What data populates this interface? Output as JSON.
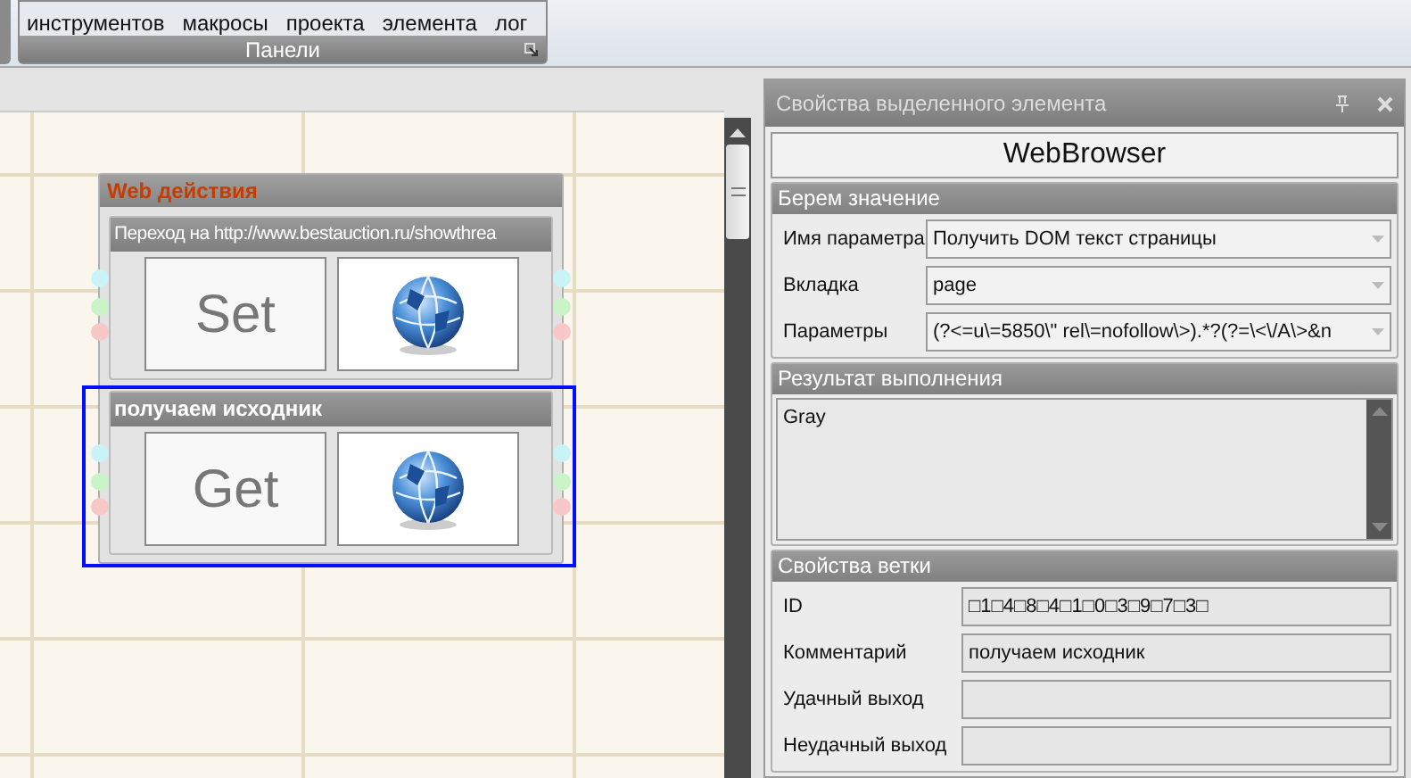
{
  "ribbon": {
    "buttons": [
      {
        "label": "инструментов"
      },
      {
        "label": "макросы"
      },
      {
        "label": "проекта"
      },
      {
        "label": "элемента"
      },
      {
        "label": "лог"
      }
    ],
    "group_label": "Панели"
  },
  "canvas": {
    "node": {
      "title": "Web действия",
      "actions": [
        {
          "title": "Переход на http://www.bestauction.ru/showthrea",
          "label": "Set",
          "selected": false
        },
        {
          "title": "получаем исходник",
          "label": "Get",
          "selected": true
        }
      ]
    }
  },
  "properties_panel": {
    "title": "Свойства выделенного элемента",
    "element_name": "WebBrowser",
    "sections": [
      {
        "title": "Берем значение",
        "kind": "fields",
        "fields": [
          {
            "label": "Имя параметра",
            "value": "Получить DOM текст страницы",
            "kind": "dropdown"
          },
          {
            "label": "Вкладка",
            "value": "page",
            "kind": "dropdown"
          },
          {
            "label": "Параметры",
            "value": "(?<=u\\=5850\\\" rel\\=nofollow\\>).*?(?=\\<\\/A\\>&n",
            "kind": "dropdown"
          }
        ]
      },
      {
        "title": "Результат выполнения",
        "kind": "text",
        "value": "Gray"
      },
      {
        "title": "Свойства ветки",
        "kind": "fields",
        "fields": [
          {
            "label": "ID",
            "value": "□1□4□8□4□1□0□3□9□7□3□",
            "kind": "textbox"
          },
          {
            "label": "Комментарий",
            "value": "получаем исходник",
            "kind": "textbox"
          },
          {
            "label": "Удачный выход",
            "kind": "textbox"
          },
          {
            "label": "Неудачный выход",
            "kind": "textbox"
          }
        ]
      }
    ]
  }
}
